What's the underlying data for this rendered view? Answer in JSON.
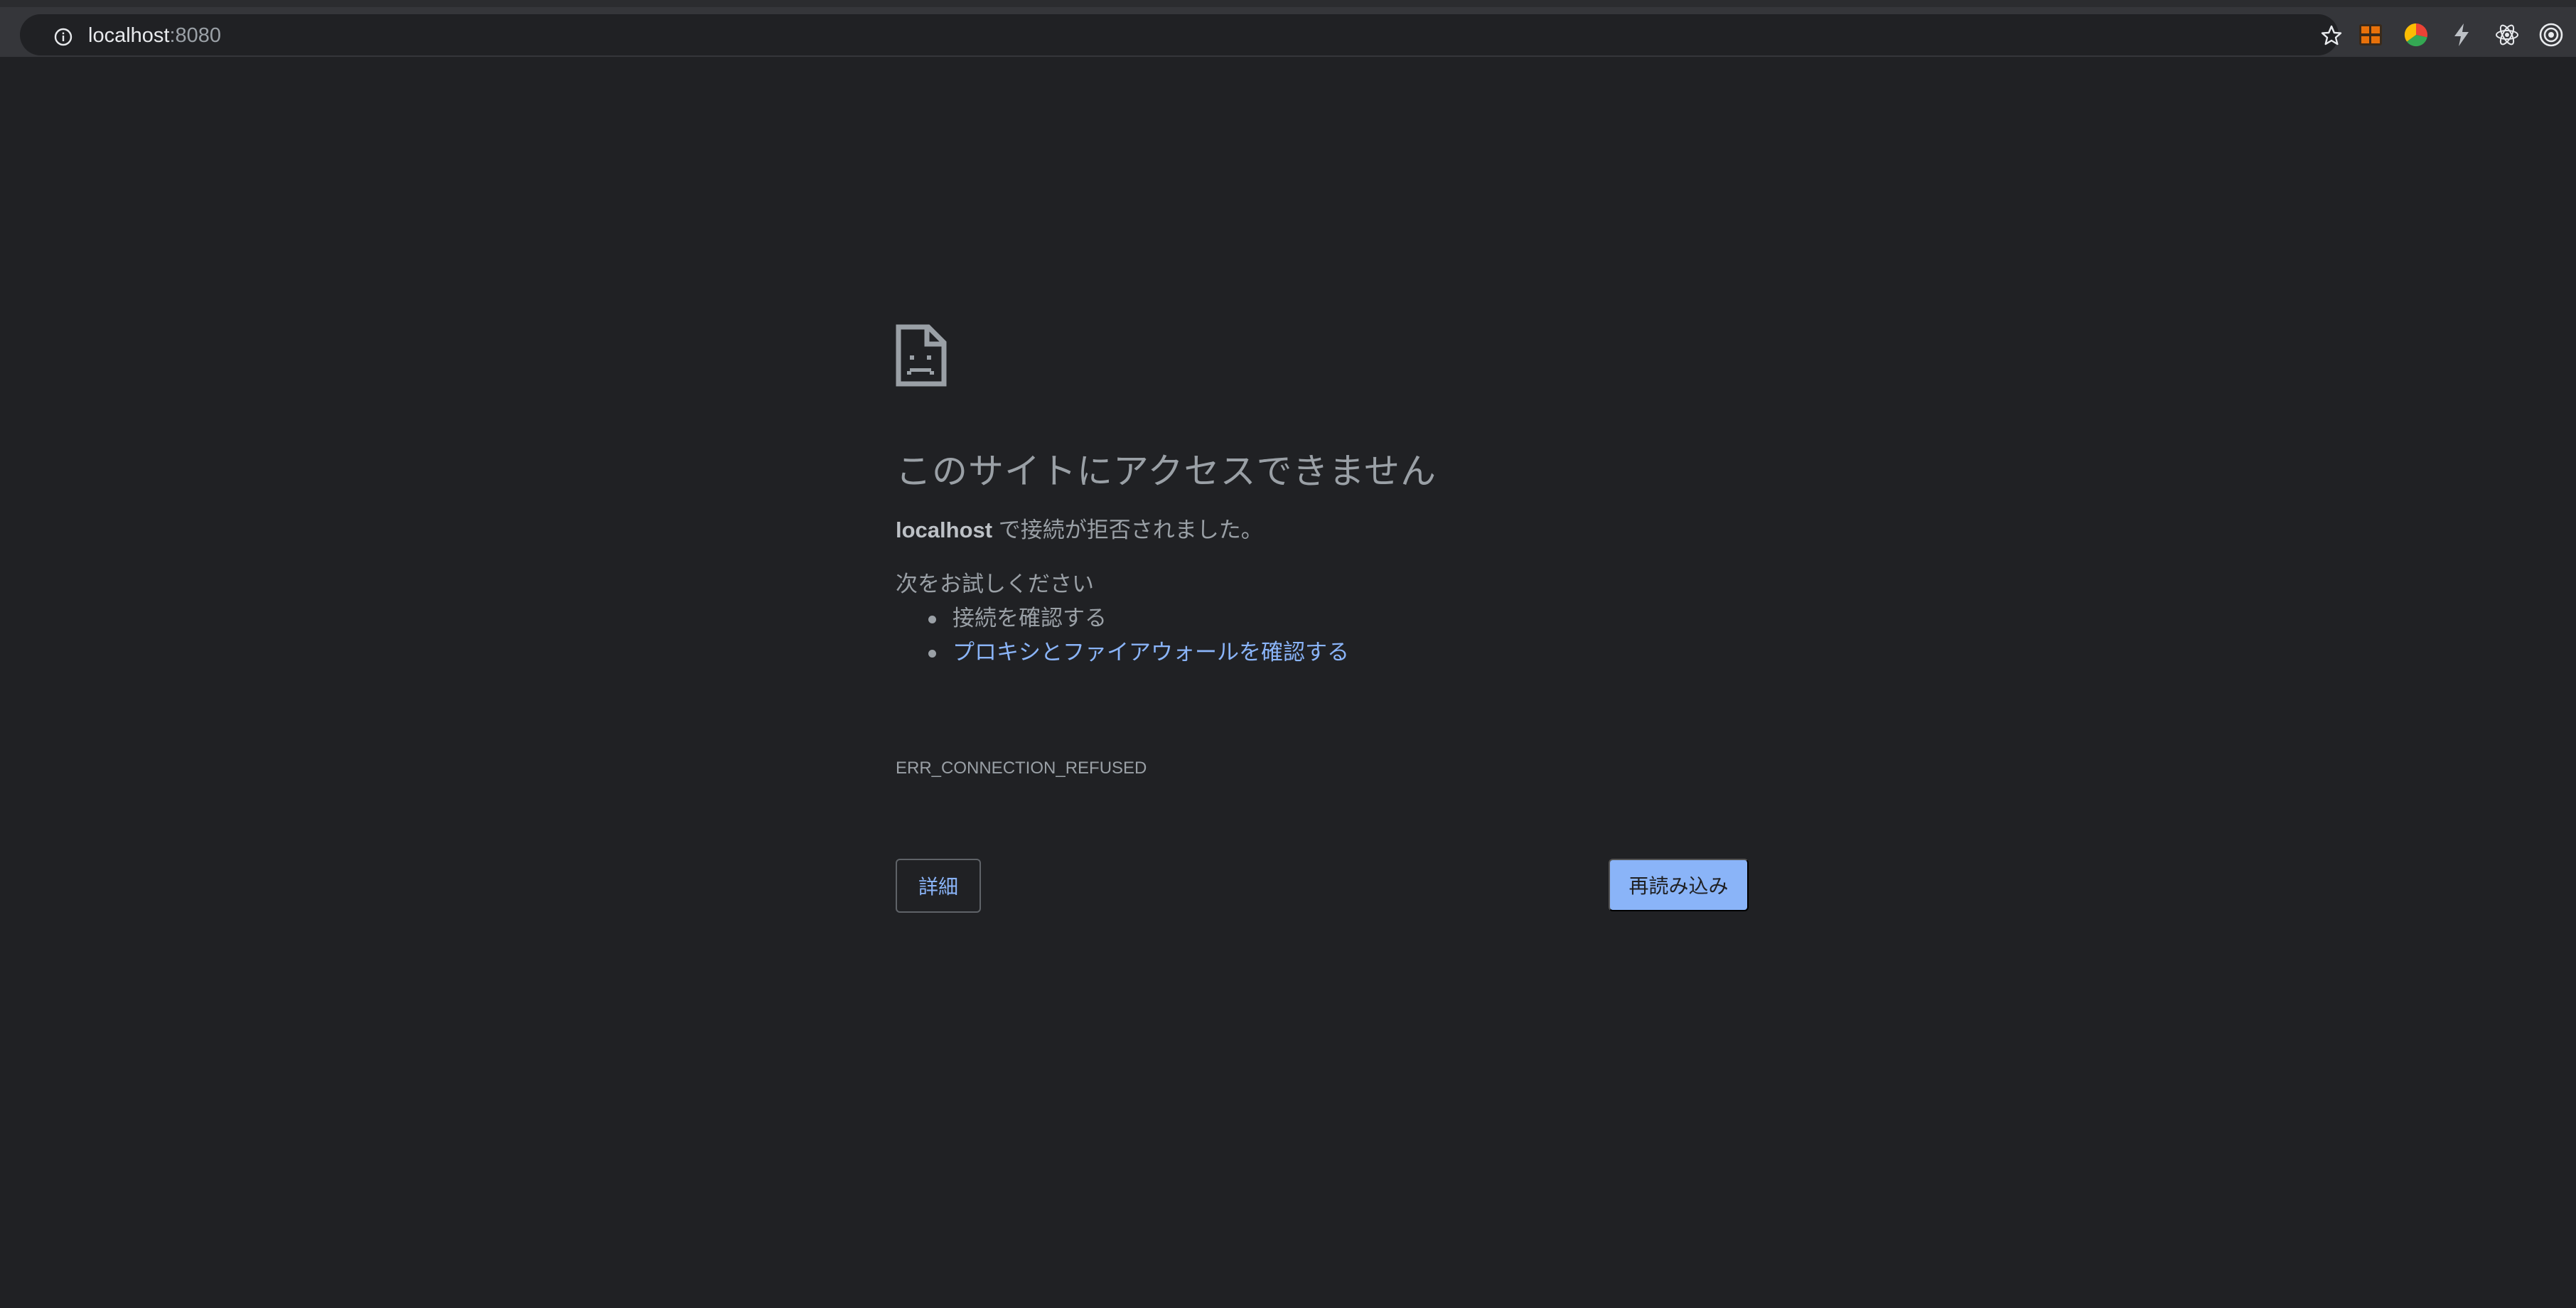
{
  "browser": {
    "url_host": "localhost",
    "url_port": ":8080",
    "extensions": [
      {
        "icon": "sushi-extension-icon",
        "color": "#e8710a"
      },
      {
        "icon": "color-wheel-extension-icon",
        "color": "#34a853"
      },
      {
        "icon": "bolt-extension-icon",
        "color": "#bdc1c6"
      },
      {
        "icon": "react-devtools-icon",
        "color": "#e8eaed"
      },
      {
        "icon": "target-extension-icon",
        "color": "#e8eaed"
      }
    ]
  },
  "error_page": {
    "icon": "sad-document-icon",
    "title": "このサイトにアクセスできません",
    "summary_host": "localhost",
    "summary_text": " で接続が拒否されました。",
    "try_heading": "次をお試しください",
    "suggestions": [
      {
        "text": "接続を確認する",
        "is_link": false
      },
      {
        "text": "プロキシとファイアウォールを確認する",
        "is_link": true
      }
    ],
    "error_code": "ERR_CONNECTION_REFUSED",
    "details_label": "詳細",
    "reload_label": "再読み込み"
  },
  "colors": {
    "background": "#202124",
    "text": "#9aa0a6",
    "link": "#8ab4f8",
    "primary_button": "#8ab4f8"
  }
}
